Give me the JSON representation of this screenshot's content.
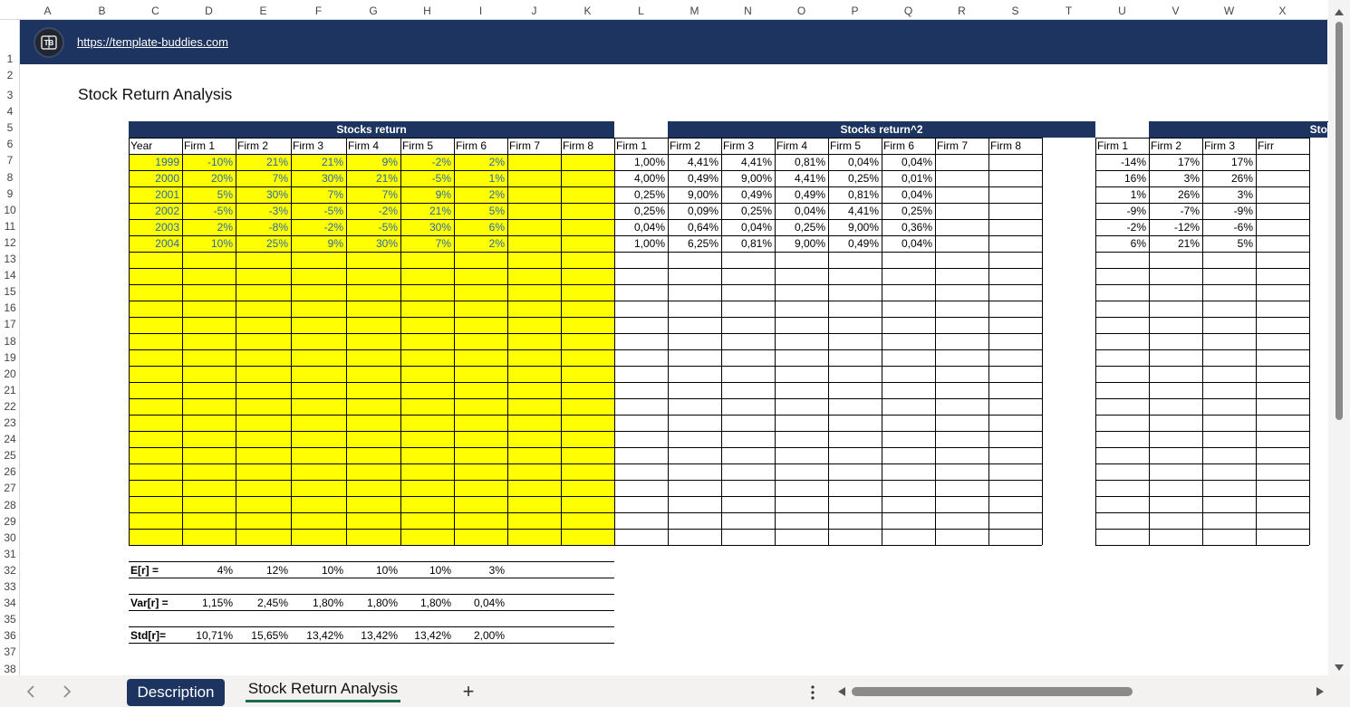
{
  "columns": [
    "A",
    "B",
    "C",
    "D",
    "E",
    "F",
    "G",
    "H",
    "I",
    "J",
    "K",
    "L",
    "M",
    "N",
    "O",
    "P",
    "Q",
    "R",
    "S",
    "T",
    "U",
    "V",
    "W",
    "X"
  ],
  "rows": [
    "1",
    "2",
    "3",
    "4",
    "5",
    "6",
    "7",
    "8",
    "9",
    "10",
    "11",
    "12",
    "13",
    "14",
    "15",
    "16",
    "17",
    "18",
    "19",
    "20",
    "21",
    "22",
    "23",
    "24",
    "25",
    "26",
    "27",
    "28",
    "29",
    "30",
    "31",
    "32",
    "33",
    "34",
    "35",
    "36",
    "37",
    "38"
  ],
  "banner": {
    "url": "https://template-buddies.com",
    "logo_text": "TB"
  },
  "title": "Stock Return Analysis",
  "returns_table": {
    "title": "Stocks return",
    "headers": [
      "Year",
      "Firm 1",
      "Firm 2",
      "Firm 3",
      "Firm 4",
      "Firm 5",
      "Firm 6",
      "Firm 7",
      "Firm 8"
    ],
    "rows": [
      [
        "1999",
        "-10%",
        "21%",
        "21%",
        "9%",
        "-2%",
        "2%",
        "",
        ""
      ],
      [
        "2000",
        "20%",
        "7%",
        "30%",
        "21%",
        "-5%",
        "1%",
        "",
        ""
      ],
      [
        "2001",
        "5%",
        "30%",
        "7%",
        "7%",
        "9%",
        "2%",
        "",
        ""
      ],
      [
        "2002",
        "-5%",
        "-3%",
        "-5%",
        "-2%",
        "21%",
        "5%",
        "",
        ""
      ],
      [
        "2003",
        "2%",
        "-8%",
        "-2%",
        "-5%",
        "30%",
        "6%",
        "",
        ""
      ],
      [
        "2004",
        "10%",
        "25%",
        "9%",
        "30%",
        "7%",
        "2%",
        "",
        ""
      ]
    ]
  },
  "squared_table": {
    "title": "Stocks return^2",
    "headers": [
      "Firm 1",
      "Firm 2",
      "Firm 3",
      "Firm 4",
      "Firm 5",
      "Firm 6",
      "Firm 7",
      "Firm 8"
    ],
    "rows": [
      [
        "1,00%",
        "4,41%",
        "4,41%",
        "0,81%",
        "0,04%",
        "0,04%",
        "",
        ""
      ],
      [
        "4,00%",
        "0,49%",
        "9,00%",
        "4,41%",
        "0,25%",
        "0,01%",
        "",
        ""
      ],
      [
        "0,25%",
        "9,00%",
        "0,49%",
        "0,49%",
        "0,81%",
        "0,04%",
        "",
        ""
      ],
      [
        "0,25%",
        "0,09%",
        "0,25%",
        "0,04%",
        "4,41%",
        "0,25%",
        "",
        ""
      ],
      [
        "0,04%",
        "0,64%",
        "0,04%",
        "0,25%",
        "9,00%",
        "0,36%",
        "",
        ""
      ],
      [
        "1,00%",
        "6,25%",
        "0,81%",
        "9,00%",
        "0,49%",
        "0,04%",
        "",
        ""
      ]
    ]
  },
  "third_table": {
    "title": "Sto",
    "headers": [
      "Firm 1",
      "Firm 2",
      "Firm 3",
      "Firr"
    ],
    "rows": [
      [
        "-14%",
        "17%",
        "17%"
      ],
      [
        "16%",
        "3%",
        "26%"
      ],
      [
        "1%",
        "26%",
        "3%"
      ],
      [
        "-9%",
        "-7%",
        "-9%"
      ],
      [
        "-2%",
        "-12%",
        "-6%"
      ],
      [
        "6%",
        "21%",
        "5%"
      ]
    ]
  },
  "summary": [
    {
      "label": "E[r] =",
      "values": [
        "4%",
        "12%",
        "10%",
        "10%",
        "10%",
        "3%"
      ]
    },
    {
      "label": "Var[r] =",
      "values": [
        "1,15%",
        "2,45%",
        "1,80%",
        "1,80%",
        "1,80%",
        "0,04%"
      ]
    },
    {
      "label": "Std[r]=",
      "values": [
        "10,71%",
        "15,65%",
        "13,42%",
        "13,42%",
        "13,42%",
        "2,00%"
      ]
    }
  ],
  "sheet_tabs": [
    "Description",
    "Stock Return Analysis"
  ],
  "add_sheet_label": "+",
  "colors": {
    "header_navy": "#1d3461",
    "input_yellow": "#ffff00",
    "input_text_blue": "#2a67b4"
  }
}
